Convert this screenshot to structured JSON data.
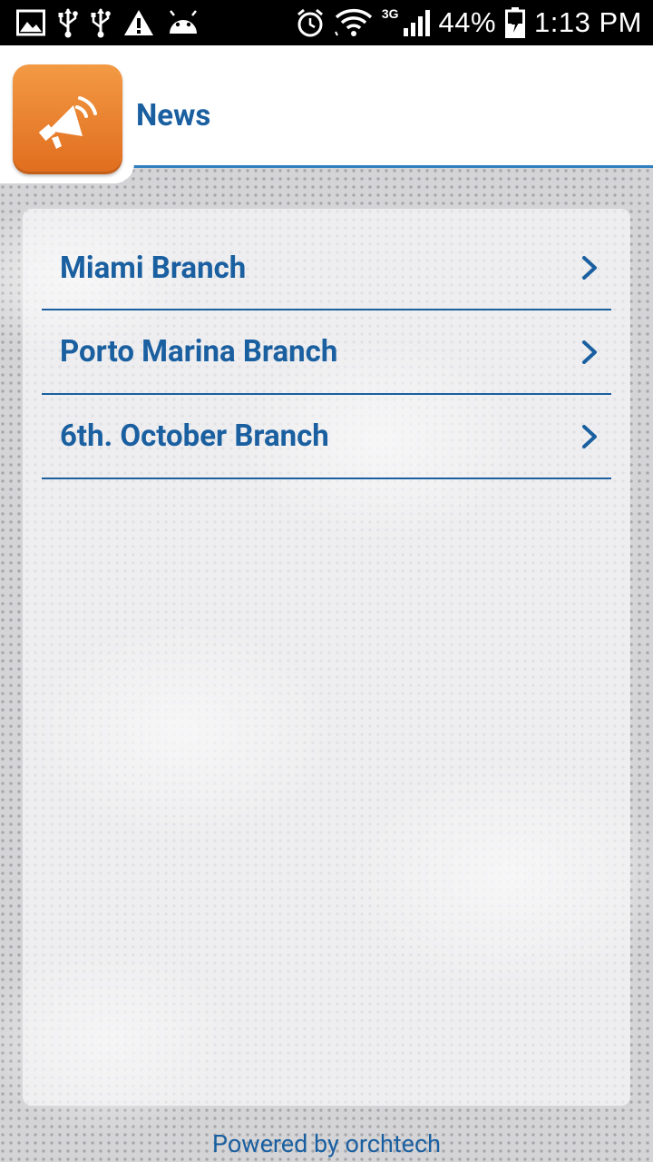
{
  "status_bar": {
    "network_type": "3G",
    "battery_percent": "44%",
    "time": "1:13 PM",
    "icons": [
      "image-icon",
      "usb-icon",
      "usb-icon",
      "warning-icon",
      "android-icon",
      "alarm-icon",
      "wifi-icon",
      "signal-icon",
      "battery-charging-icon"
    ]
  },
  "header": {
    "title": "News",
    "logo_icon": "megaphone-icon",
    "logo_color": "#e8782a"
  },
  "branches": [
    {
      "label": "Miami Branch"
    },
    {
      "label": "Porto Marina Branch"
    },
    {
      "label": "6th. October Branch"
    }
  ],
  "footer": {
    "text": "Powered by orchtech"
  },
  "colors": {
    "accent": "#1a5fa0",
    "header_rule": "#2f7fbf"
  }
}
